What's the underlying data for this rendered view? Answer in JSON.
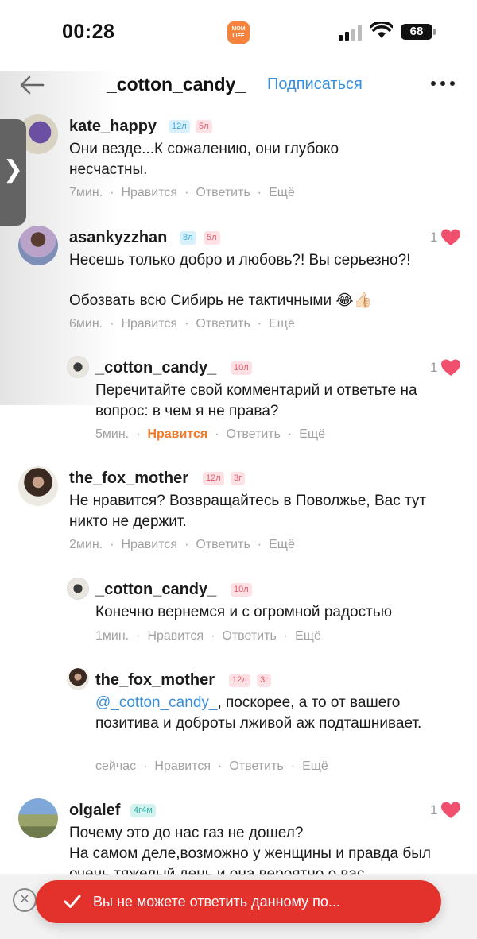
{
  "status_bar": {
    "time": "00:28",
    "app_badge": "MOM LIFE",
    "battery": "68"
  },
  "header": {
    "username": "_cotton_candy_",
    "subscribe": "Подписаться"
  },
  "side_tab": {
    "glyph": "❯"
  },
  "comments": [
    {
      "user": "kate_happy",
      "badges": [
        "12л",
        "5л"
      ],
      "text": "Они везде...К сожалению, они глубоко несчастны.",
      "time": "7мин.",
      "like_label": "Нравится",
      "reply_label": "Ответить",
      "more_label": "Ещё"
    },
    {
      "user": "asankyzzhan",
      "badges": [
        "8л",
        "5л"
      ],
      "likes": "1",
      "text_line1": "Несешь только добро и любовь?! Вы серьезно?!",
      "text_line2": "Обозвать всю Сибирь не тактичными 😂👍🏻",
      "time": "6мин.",
      "like_label": "Нравится",
      "reply_label": "Ответить",
      "more_label": "Ещё"
    },
    {
      "user": "_cotton_candy_",
      "badges": [
        "10л"
      ],
      "likes": "1",
      "text": "Перечитайте свой комментарий и ответьте на вопрос: в чем я не права?",
      "time": "5мин.",
      "like_label": "Нравится",
      "reply_label": "Ответить",
      "more_label": "Ещё"
    },
    {
      "user": "the_fox_mother",
      "badges": [
        "12л",
        "3г"
      ],
      "text": "Не нравится? Возвращайтесь в Поволжье, Вас тут никто не держит.",
      "time": "2мин.",
      "like_label": "Нравится",
      "reply_label": "Ответить",
      "more_label": "Ещё"
    },
    {
      "user": "_cotton_candy_",
      "badges": [
        "10л"
      ],
      "text": "Конечно вернемся и с огромной радостью",
      "time": "1мин.",
      "like_label": "Нравится",
      "reply_label": "Ответить",
      "more_label": "Ещё"
    },
    {
      "user": "the_fox_mother",
      "badges": [
        "12л",
        "3г"
      ],
      "mention": "@_cotton_candy_",
      "text": ", поскорее, а то от вашего позитива и доброты лживой аж подташнивает.",
      "time": "сейчас",
      "like_label": "Нравится",
      "reply_label": "Ответить",
      "more_label": "Ещё"
    },
    {
      "user": "olgalef",
      "badges": [
        "4г4м"
      ],
      "likes": "1",
      "text_line1": "Почему это до нас газ не дошел?",
      "text_line2": "На самом деле,возможно у женщины и правда был очень тяжелый день и она вероятно о вас"
    }
  ],
  "toast": {
    "message": "Вы не можете ответить данному по..."
  },
  "colors": {
    "accent_blue": "#3a8fd9",
    "liked_orange": "#f07a2a",
    "heart": "#f0506e",
    "toast_red": "#e3322c"
  }
}
